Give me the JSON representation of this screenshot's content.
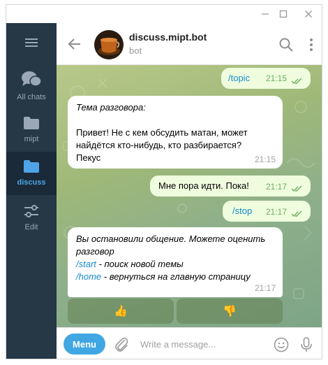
{
  "window": {
    "controls": [
      "minimize-icon",
      "maximize-icon",
      "close-icon"
    ]
  },
  "sidebar": {
    "items": [
      {
        "id": "menu",
        "icon": "hamburger-icon",
        "label": ""
      },
      {
        "id": "all-chats",
        "icon": "chats-icon",
        "label": "All chats"
      },
      {
        "id": "mipt",
        "icon": "folder-icon",
        "label": "mipt"
      },
      {
        "id": "discuss",
        "icon": "folder-icon",
        "label": "discuss",
        "active": true
      },
      {
        "id": "edit",
        "icon": "sliders-icon",
        "label": "Edit"
      }
    ]
  },
  "header": {
    "title": "discuss.mipt.bot",
    "subtitle": "bot"
  },
  "messages": [
    {
      "dir": "out",
      "text": "/topic",
      "time": "21:15",
      "read": true
    },
    {
      "dir": "in",
      "lines": [
        "Тема разговора:",
        "",
        "Привет! Не с кем обсудить матан, может",
        "найдётся кто-нибудь, кто разбирается?",
        "Пекус"
      ],
      "time": "21:15"
    },
    {
      "dir": "out",
      "text": "Мне пора идти. Пока!",
      "time": "21:17",
      "read": true
    },
    {
      "dir": "out",
      "text": "/stop",
      "time": "21:17",
      "read": true
    },
    {
      "dir": "in",
      "line1": "Вы остановили общение. Можете оценить",
      "line2": "разговор",
      "cmd1": "/start",
      "cmd1_desc": " - поиск новой темы",
      "cmd2": "/home",
      "cmd2_desc": " - вернуться на главную страницу",
      "time": "21:17"
    }
  ],
  "inline_keyboard": [
    {
      "label": "👍",
      "icon": "thumbs-up-icon"
    },
    {
      "label": "👎",
      "icon": "thumbs-down-icon"
    }
  ],
  "composer": {
    "menu_label": "Menu",
    "placeholder": "Write a message..."
  },
  "colors": {
    "sidebar_bg": "#263746",
    "sidebar_active": "#1a2a38",
    "accent": "#40a7e3",
    "link": "#168acd",
    "outgoing_bubble": "#effdde",
    "read_ticks": "#6eac5e"
  }
}
